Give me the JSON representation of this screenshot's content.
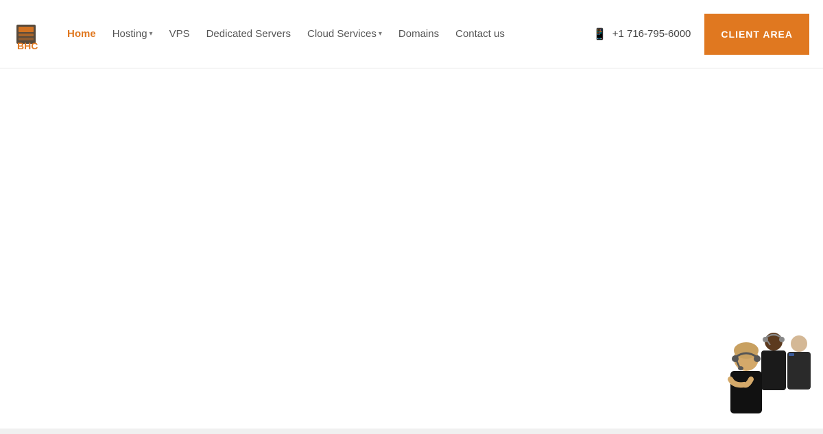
{
  "logo": {
    "text": "BHC",
    "alt": "BHC Logo"
  },
  "nav": {
    "items": [
      {
        "label": "Home",
        "active": true,
        "has_dropdown": false,
        "id": "home"
      },
      {
        "label": "Hosting",
        "active": false,
        "has_dropdown": true,
        "id": "hosting"
      },
      {
        "label": "VPS",
        "active": false,
        "has_dropdown": false,
        "id": "vps"
      },
      {
        "label": "Dedicated Servers",
        "active": false,
        "has_dropdown": false,
        "id": "dedicated-servers"
      },
      {
        "label": "Cloud Services",
        "active": false,
        "has_dropdown": true,
        "id": "cloud-services"
      },
      {
        "label": "Domains",
        "active": false,
        "has_dropdown": false,
        "id": "domains"
      },
      {
        "label": "Contact us",
        "active": false,
        "has_dropdown": false,
        "id": "contact-us"
      }
    ]
  },
  "phone": {
    "number": "+1 716-795-6000",
    "display": "+1 716-795-6000"
  },
  "client_area": {
    "label": "CLIENT AREA"
  },
  "colors": {
    "accent": "#e07820",
    "active_nav": "#e07820",
    "nav_default": "#555555"
  }
}
